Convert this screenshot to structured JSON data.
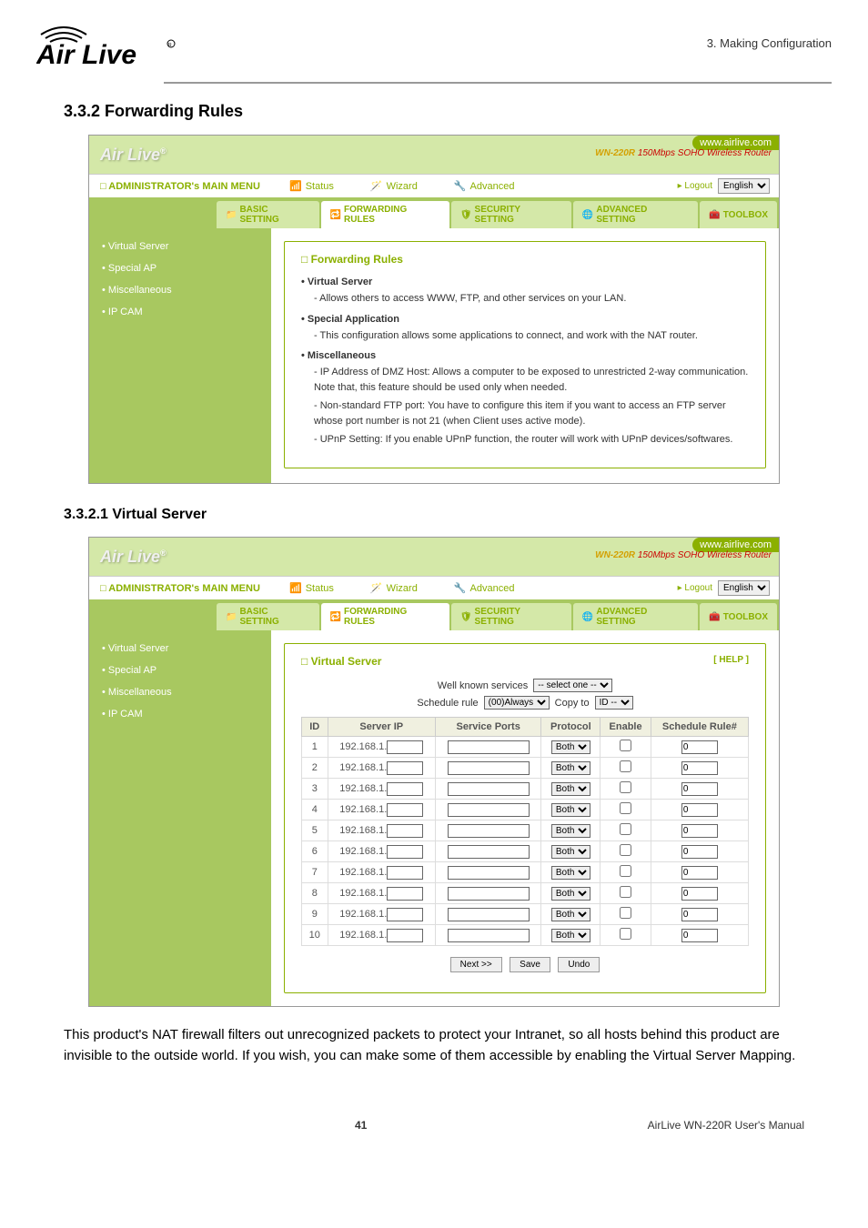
{
  "chapter_ref": "3. Making Configuration",
  "brand_wordmark": "Air Live",
  "section_title": "3.3.2 Forwarding Rules",
  "subsection_title": "3.3.2.1 Virtual Server",
  "body_text": "This product's NAT firewall filters out unrecognized packets to protect your Intranet, so all hosts behind this product are invisible to the outside world. If you wish, you can make some of them accessible by enabling the Virtual Server Mapping.",
  "page_number": "41",
  "manual_title": "AirLive WN-220R User's Manual",
  "panel": {
    "brand": "Air Live",
    "badge": "www.airlive.com",
    "model": "WN-220R",
    "model_desc": "150Mbps SOHO Wireless Router",
    "admin_label": "ADMINISTRATOR's MAIN MENU",
    "status": "Status",
    "wizard": "Wizard",
    "advanced": "Advanced",
    "logout": "Logout",
    "lang": "English",
    "tabs": [
      "BASIC SETTING",
      "FORWARDING RULES",
      "SECURITY SETTING",
      "ADVANCED SETTING",
      "TOOLBOX"
    ],
    "side_items": [
      "Virtual Server",
      "Special AP",
      "Miscellaneous",
      "IP CAM"
    ]
  },
  "panel1": {
    "box_title": "Forwarding Rules",
    "items": [
      {
        "head": "Virtual Server",
        "subs": [
          "Allows others to access WWW, FTP, and other services on your LAN."
        ]
      },
      {
        "head": "Special Application",
        "subs": [
          "This configuration allows some applications to connect, and work with the NAT router."
        ]
      },
      {
        "head": "Miscellaneous",
        "subs": [
          "IP Address of DMZ Host: Allows a computer to be exposed to unrestricted 2-way communication. Note that, this feature should be used only when needed.",
          "Non-standard FTP port: You have to configure this item if you want to access an FTP server whose port number is not 21 (when Client uses active mode).",
          "UPnP Setting: If you enable UPnP function, the router will work with UPnP devices/softwares."
        ]
      }
    ]
  },
  "panel2": {
    "box_title": "Virtual Server",
    "help": "[ HELP ]",
    "wk_label": "Well known services",
    "wk_value": "-- select one --",
    "sr_label": "Schedule rule",
    "sr_value": "(00)Always",
    "copy_label": "Copy to",
    "copy_value": "ID --",
    "headers": [
      "ID",
      "Server IP",
      "Service Ports",
      "Protocol",
      "Enable",
      "Schedule Rule#"
    ],
    "ip_prefix": "192.168.1.",
    "protocol": "Both",
    "rule_val": "0",
    "rows": [
      1,
      2,
      3,
      4,
      5,
      6,
      7,
      8,
      9,
      10
    ],
    "buttons": {
      "next": "Next >>",
      "save": "Save",
      "undo": "Undo"
    }
  }
}
